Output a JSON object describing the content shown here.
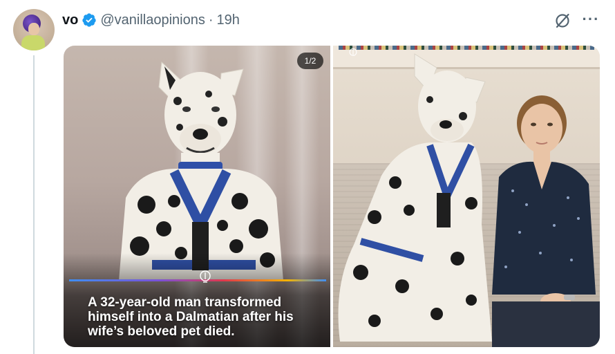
{
  "tweet": {
    "display_name": "vo",
    "handle": "@vanillaopinions",
    "separator": "·",
    "time": "19h",
    "verified": true,
    "avatar_icon": "avatar-image",
    "actions": {
      "grok_icon": "grok-icon",
      "more_label": "···"
    }
  },
  "media": {
    "counter": "1/2",
    "caption": "A 32-year-old man transformed himself into a Dalmatian after his wife’s beloved pet died.",
    "colors": {
      "verified_badge": "#1d9bf0",
      "caption_text": "#ffffff"
    },
    "images": [
      {
        "name": "man-in-dalmatian-costume-photo"
      },
      {
        "name": "man-in-dalmatian-costume-with-woman-photo"
      }
    ]
  }
}
